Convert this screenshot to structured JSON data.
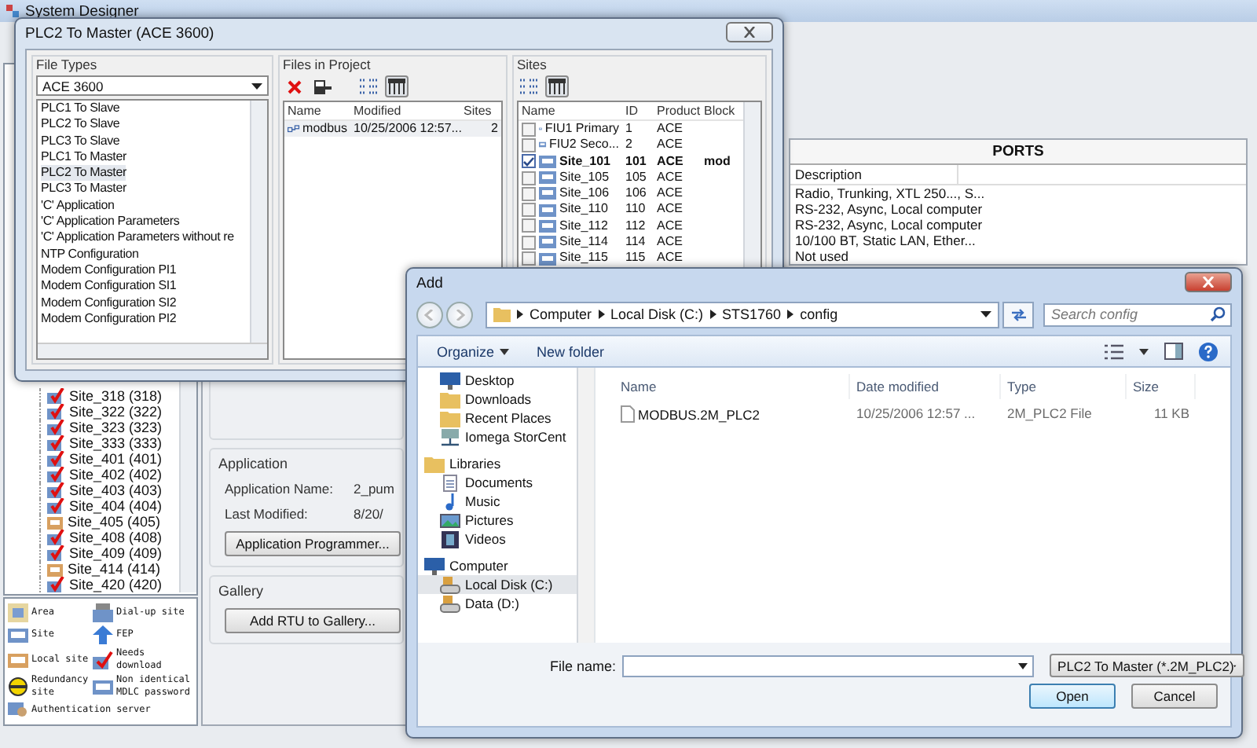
{
  "app": {
    "title": "System Designer",
    "site_tree": [
      {
        "label": "Site_318 (318)",
        "kind": "needs_download"
      },
      {
        "label": "Site_322 (322)",
        "kind": "needs_download"
      },
      {
        "label": "Site_323 (323)",
        "kind": "needs_download"
      },
      {
        "label": "Site_333 (333)",
        "kind": "needs_download"
      },
      {
        "label": "Site_401 (401)",
        "kind": "needs_download"
      },
      {
        "label": "Site_402 (402)",
        "kind": "needs_download"
      },
      {
        "label": "Site_403 (403)",
        "kind": "needs_download"
      },
      {
        "label": "Site_404 (404)",
        "kind": "needs_download"
      },
      {
        "label": "Site_405 (405)",
        "kind": "local_site"
      },
      {
        "label": "Site_408 (408)",
        "kind": "needs_download"
      },
      {
        "label": "Site_409 (409)",
        "kind": "needs_download"
      },
      {
        "label": "Site_414 (414)",
        "kind": "local_site"
      },
      {
        "label": "Site_420 (420)",
        "kind": "needs_download"
      }
    ],
    "legend": [
      {
        "label": "Area",
        "kind": "area"
      },
      {
        "label": "Dial-up site",
        "kind": "dialup"
      },
      {
        "label": "Site",
        "kind": "site"
      },
      {
        "label": "FEP",
        "kind": "fep"
      },
      {
        "label": "Local site",
        "kind": "local_site"
      },
      {
        "label": "Needs download",
        "kind": "needs_download"
      },
      {
        "label": "Redundancy site",
        "kind": "redundancy"
      },
      {
        "label": "Non identical MDLC password",
        "kind": "mdlc"
      },
      {
        "label": "Authentication server",
        "kind": "auth"
      }
    ],
    "application": {
      "title": "Application",
      "fields": [
        {
          "label": "Application Name:",
          "value": "2_pum"
        },
        {
          "label": "Last Modified:",
          "value": "8/20/"
        }
      ],
      "button": "Application Programmer..."
    },
    "gallery": {
      "title": "Gallery",
      "button": "Add RTU to Gallery..."
    },
    "ports": {
      "title": "PORTS",
      "columns": [
        "Description"
      ],
      "rows": [
        "Radio, Trunking, XTL 250..., S...",
        "RS-232, Async, Local computer",
        "RS-232, Async, Local computer",
        "10/100 BT, Static LAN, Ether...",
        "Not used"
      ]
    }
  },
  "file_dialog": {
    "title": "PLC2 To Master (ACE 3600)",
    "file_types": {
      "title": "File Types",
      "dropdown": "ACE 3600",
      "items": [
        {
          "label": "PLC1 To Slave",
          "selected": false
        },
        {
          "label": "PLC2 To Slave",
          "selected": false
        },
        {
          "label": "PLC3 To Slave",
          "selected": false
        },
        {
          "label": "PLC1 To Master",
          "selected": false
        },
        {
          "label": "PLC2 To Master",
          "selected": true
        },
        {
          "label": "PLC3 To Master",
          "selected": false
        },
        {
          "label": "'C' Application",
          "selected": false
        },
        {
          "label": "'C' Application Parameters",
          "selected": false
        },
        {
          "label": "'C' Application Parameters without re",
          "selected": false
        },
        {
          "label": "NTP Configuration",
          "selected": false
        },
        {
          "label": "Modem Configuration PI1",
          "selected": false
        },
        {
          "label": "Modem Configuration SI1",
          "selected": false
        },
        {
          "label": "Modem Configuration SI2",
          "selected": false
        },
        {
          "label": "Modem Configuration PI2",
          "selected": false
        }
      ]
    },
    "files": {
      "title": "Files in Project",
      "views": [
        {
          "kind": "list",
          "selected": false
        },
        {
          "kind": "details",
          "selected": true
        }
      ],
      "columns": [
        "Name",
        "Modified",
        "Sites"
      ],
      "rows": [
        {
          "name": "modbus",
          "modified": "10/25/2006 12:57...",
          "sites": "2"
        }
      ]
    },
    "sites": {
      "title": "Sites",
      "views": [
        {
          "kind": "list",
          "selected": false
        },
        {
          "kind": "details",
          "selected": true
        }
      ],
      "columns": [
        "Name",
        "ID",
        "Product",
        "Block"
      ],
      "rows": [
        {
          "name": "FIU1 Primary",
          "id": "1",
          "product": "ACE",
          "checked": false
        },
        {
          "name": "FIU2 Seco...",
          "id": "2",
          "product": "ACE",
          "checked": false
        },
        {
          "name": "Site_101",
          "id": "101",
          "product": "ACE",
          "block": "mod",
          "checked": true
        },
        {
          "name": "Site_105",
          "id": "105",
          "product": "ACE",
          "checked": false
        },
        {
          "name": "Site_106",
          "id": "106",
          "product": "ACE",
          "checked": false
        },
        {
          "name": "Site_110",
          "id": "110",
          "product": "ACE",
          "checked": false
        },
        {
          "name": "Site_112",
          "id": "112",
          "product": "ACE",
          "checked": false
        },
        {
          "name": "Site_114",
          "id": "114",
          "product": "ACE",
          "checked": false
        },
        {
          "name": "Site_115",
          "id": "115",
          "product": "ACE",
          "checked": false
        }
      ]
    }
  },
  "add_dialog": {
    "title": "Add",
    "breadcrumb": [
      "Computer",
      "Local Disk (C:)",
      "STS1760",
      "config"
    ],
    "search": {
      "placeholder": "Search config"
    },
    "toolbar": {
      "organize": "Organize",
      "new_folder": "New folder"
    },
    "nav_groups": [
      {
        "items": [
          {
            "label": "Desktop",
            "kind": "desktop",
            "selected": false
          },
          {
            "label": "Downloads",
            "kind": "downloads",
            "selected": false
          },
          {
            "label": "Recent Places",
            "kind": "recent",
            "selected": false
          },
          {
            "label": "Iomega StorCent",
            "kind": "network",
            "selected": false
          }
        ]
      },
      {
        "heading": {
          "label": "Libraries",
          "kind": "libraries",
          "selected": false
        },
        "items": [
          {
            "label": "Documents",
            "kind": "documents",
            "selected": false
          },
          {
            "label": "Music",
            "kind": "music",
            "selected": false
          },
          {
            "label": "Pictures",
            "kind": "pictures",
            "selected": false
          },
          {
            "label": "Videos",
            "kind": "videos",
            "selected": false
          }
        ]
      },
      {
        "heading": {
          "label": "Computer",
          "kind": "computer",
          "selected": false
        },
        "items": [
          {
            "label": "Local Disk (C:)",
            "kind": "disk",
            "selected": true
          },
          {
            "label": "Data (D:)",
            "kind": "drive",
            "selected": false
          }
        ]
      }
    ],
    "columns": [
      "Name",
      "Date modified",
      "Type",
      "Size"
    ],
    "files": [
      {
        "name": "MODBUS.2M_PLC2",
        "modified": "10/25/2006 12:57 ...",
        "type": "2M_PLC2 File",
        "size": "11 KB"
      }
    ],
    "file_name": {
      "label": "File name:"
    },
    "filter": "PLC2 To Master (*.2M_PLC2)",
    "buttons": [
      "Open",
      "Cancel"
    ]
  }
}
